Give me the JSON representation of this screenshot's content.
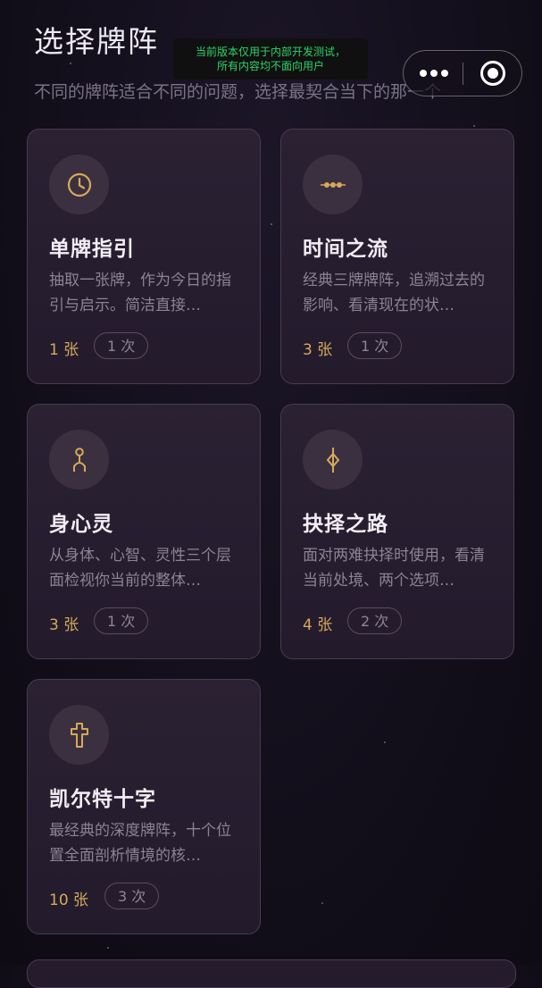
{
  "header": {
    "title": "选择牌阵",
    "subtitle": "不同的牌阵适合不同的问题，选择最契合当下的那一个"
  },
  "dev_banner": {
    "line1": "当前版本仅用于内部开发测试，",
    "line2": "所有内容均不面向用户"
  },
  "capsule": {
    "more_icon": "more-dots-icon",
    "close_icon": "target-close-icon"
  },
  "colors": {
    "accent": "#d6a95a",
    "background": "#120e1a",
    "card": "#2a2133"
  },
  "spreads": [
    {
      "name": "单牌指引",
      "desc": "抽取一张牌，作为今日的指引与启示。简洁直接…",
      "count": "1 张",
      "uses": "1 次",
      "icon": "clock-icon"
    },
    {
      "name": "时间之流",
      "desc": "经典三牌牌阵，追溯过去的影响、看清现在的状…",
      "count": "3 张",
      "uses": "1 次",
      "icon": "three-dots-line-icon"
    },
    {
      "name": "身心灵",
      "desc": "从身体、心智、灵性三个层面检视你当前的整体…",
      "count": "3 张",
      "uses": "1 次",
      "icon": "figure-icon"
    },
    {
      "name": "抉择之路",
      "desc": "面对两难抉择时使用，看清当前处境、两个选项…",
      "count": "4 张",
      "uses": "2 次",
      "icon": "diamond-cross-icon"
    },
    {
      "name": "凯尔特十字",
      "desc": "最经典的深度牌阵，十个位置全面剖析情境的核…",
      "count": "10 张",
      "uses": "3 次",
      "icon": "celtic-cross-icon"
    }
  ]
}
